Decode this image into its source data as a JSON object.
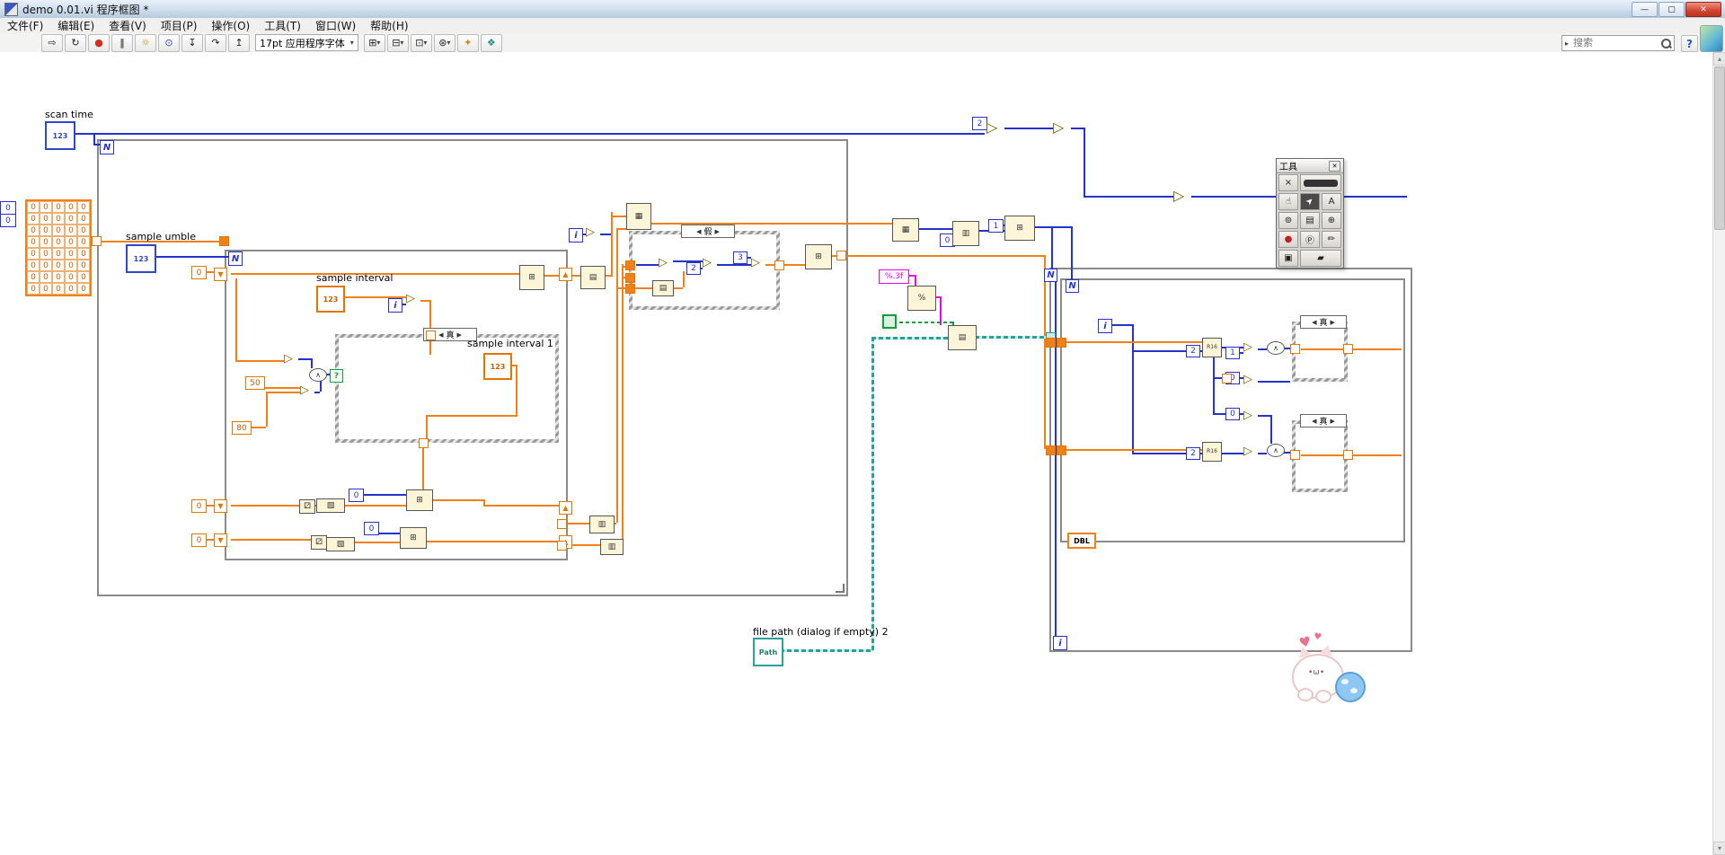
{
  "window": {
    "title": "demo 0.01.vi 程序框图 *",
    "controls": {
      "minimize": "—",
      "maximize": "▢",
      "close": "✕"
    }
  },
  "menu": {
    "items": [
      "文件(F)",
      "编辑(E)",
      "查看(V)",
      "项目(P)",
      "操作(O)",
      "工具(T)",
      "窗口(W)",
      "帮助(H)"
    ]
  },
  "toolbar": {
    "font": "17pt 应用程序字体",
    "search_placeholder": "搜索",
    "help": "?",
    "buttons": {
      "run": "⇨",
      "run_cont": "↻",
      "abort": "●",
      "pause": "‖",
      "highlight": "☼",
      "retain": "⊙",
      "step_into": "↧",
      "step_over": "↷",
      "step_out": "↥",
      "align": "⊞",
      "distribute": "⊟",
      "resize": "⊡",
      "reorder": "⊛",
      "dropdown": "▾",
      "cleanup": "✦",
      "grid": "❖"
    }
  },
  "tools_palette": {
    "title": "工具",
    "close": "✕",
    "tools": {
      "auto": "×",
      "operate": "☝",
      "position": "➤",
      "label": "A",
      "wire": "⊚",
      "menu": "▤",
      "scroll": "⊕",
      "breakpoint": "●",
      "probe": "Ⓟ",
      "dropper": "✏",
      "color_copy": "▣",
      "set_color": "▰"
    }
  },
  "diagram": {
    "labels": {
      "scan_time": "scan time",
      "sample_umble": "sample umble",
      "sample_interval": "sample interval",
      "sample_interval_1": "sample interval 1",
      "file_path": "file path (dialog if empty) 2"
    },
    "terminals": {
      "numeric": "123",
      "path": "Path",
      "dbl": "DBL"
    },
    "loops": {
      "count": "N",
      "iteration": "i"
    },
    "cases": {
      "true": "真",
      "false": "假",
      "prev": "◀",
      "next": "▶"
    },
    "constants": {
      "zero": "0",
      "one": "1",
      "two": "2",
      "three": "3",
      "fifty": "50",
      "eighty": "80",
      "format": "%.3f"
    },
    "array": {
      "value": "0",
      "rows": 8,
      "cols": 5,
      "index": "0"
    },
    "glyphs": {
      "build": "⊞",
      "grid2": "▦",
      "rows": "▤",
      "index": "▥",
      "subset": "▧",
      "dice": "⚂",
      "tri": "▷",
      "and": "∧",
      "r16": "R16",
      "fmt": "%",
      "sel": "?"
    },
    "colors": {
      "int_wire": "#2333cc",
      "dbl_wire": "#f08018",
      "bool_wire": "#0ba03c",
      "string_wire": "#ef00ef",
      "path_wire": "#2aa198"
    }
  }
}
